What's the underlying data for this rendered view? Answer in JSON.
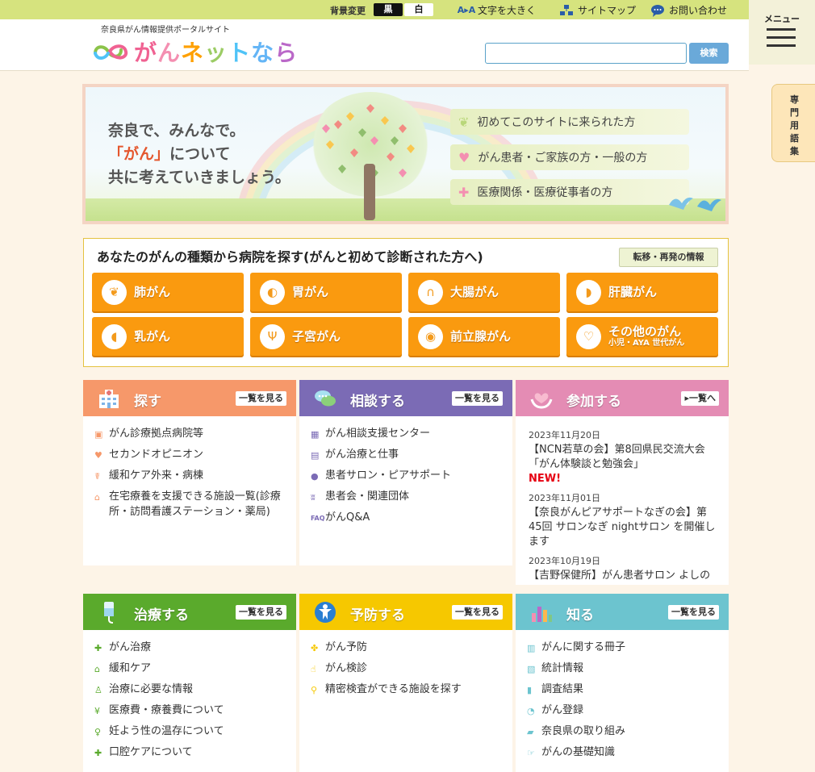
{
  "topbar": {
    "bg_label": "背景変更",
    "bg_black": "黒",
    "bg_white": "白",
    "font_bigger": "文字を大きく",
    "sitemap": "サイトマップ",
    "contact": "お問い合わせ",
    "font_icon_text": "A▸A"
  },
  "header": {
    "subtitle": "奈良県がん情報提供ポータルサイト",
    "logo_text": "がんネットなら",
    "search_button": "検索",
    "search_placeholder": ""
  },
  "menu": {
    "label": "メニュー"
  },
  "glossary": {
    "chars": [
      "専",
      "門",
      "用",
      "語",
      "集"
    ]
  },
  "hero": {
    "tagline_1": "奈良で、みんなで。",
    "tagline_2_accent": "「がん」",
    "tagline_2_rest": "について",
    "tagline_3": "共に考えていきましょう。",
    "pills": [
      {
        "label": "初めてこのサイトに来られた方",
        "icon": "sprout-icon"
      },
      {
        "label": "がん患者・ご家族の方・一般の方",
        "icon": "heart-icon"
      },
      {
        "label": "医療関係・医療従事者の方",
        "icon": "cross-icon"
      }
    ]
  },
  "types": {
    "title": "あなたのがんの種類から病院を探す(がんと初めて診断された方へ)",
    "recurrence": "転移・再発の情報",
    "buttons": [
      {
        "label": "肺がん",
        "icon": "lungs-icon",
        "sub": ""
      },
      {
        "label": "胃がん",
        "icon": "stomach-icon",
        "sub": ""
      },
      {
        "label": "大腸がん",
        "icon": "colon-icon",
        "sub": ""
      },
      {
        "label": "肝臓がん",
        "icon": "liver-icon",
        "sub": ""
      },
      {
        "label": "乳がん",
        "icon": "breast-icon",
        "sub": ""
      },
      {
        "label": "子宮がん",
        "icon": "uterus-icon",
        "sub": ""
      },
      {
        "label": "前立腺がん",
        "icon": "prostate-icon",
        "sub": ""
      },
      {
        "label": "その他のがん",
        "icon": "ribbon-icon",
        "sub": "小児・AYA 世代がん"
      }
    ]
  },
  "cards": {
    "search": {
      "title": "探す",
      "more": "一覧を見る",
      "color": "#f6986a",
      "items": [
        "がん診療拠点病院等",
        "セカンドオピニオン",
        "緩和ケア外来・病棟",
        "在宅療養を支援できる施設一覧(診療所・訪問看護ステーション・薬局)"
      ]
    },
    "consult": {
      "title": "相談する",
      "more": "一覧を見る",
      "color": "#7b6bb5",
      "items": [
        "がん相談支援センター",
        "がん治療と仕事",
        "患者サロン・ピアサポート",
        "患者会・関連団体",
        "がんQ&A"
      ]
    },
    "join": {
      "title": "参加する",
      "more": "一覧へ",
      "color": "#e48cb4",
      "news": [
        {
          "date": "2023年11月20日",
          "text": "【NCN若草の会】第8回県民交流大会「がん体験談と勉強会」",
          "badge": "NEW!"
        },
        {
          "date": "2023年11月01日",
          "text": "【奈良がんピアサポートなぎの会】第45回 サロンなぎ nightサロン を開催します",
          "badge": ""
        },
        {
          "date": "2023年10月19日",
          "text": "【吉野保健所】がん患者サロン よしの",
          "badge": ""
        }
      ]
    },
    "treat": {
      "title": "治療する",
      "more": "一覧を見る",
      "color": "#5aaa2c",
      "items": [
        "がん治療",
        "緩和ケア",
        "治療に必要な情報",
        "医療費・療養費について",
        "妊よう性の温存について",
        "口腔ケアについて"
      ]
    },
    "prevent": {
      "title": "予防する",
      "more": "一覧を見る",
      "color": "#f6c800",
      "items": [
        "がん予防",
        "がん検診",
        "精密検査ができる施設を探す"
      ]
    },
    "know": {
      "title": "知る",
      "more": "一覧を見る",
      "color": "#6cc4cf",
      "items": [
        "がんに関する冊子",
        "統計情報",
        "調査結果",
        "がん登録",
        "奈良県の取り組み",
        "がんの基礎知識"
      ]
    }
  }
}
